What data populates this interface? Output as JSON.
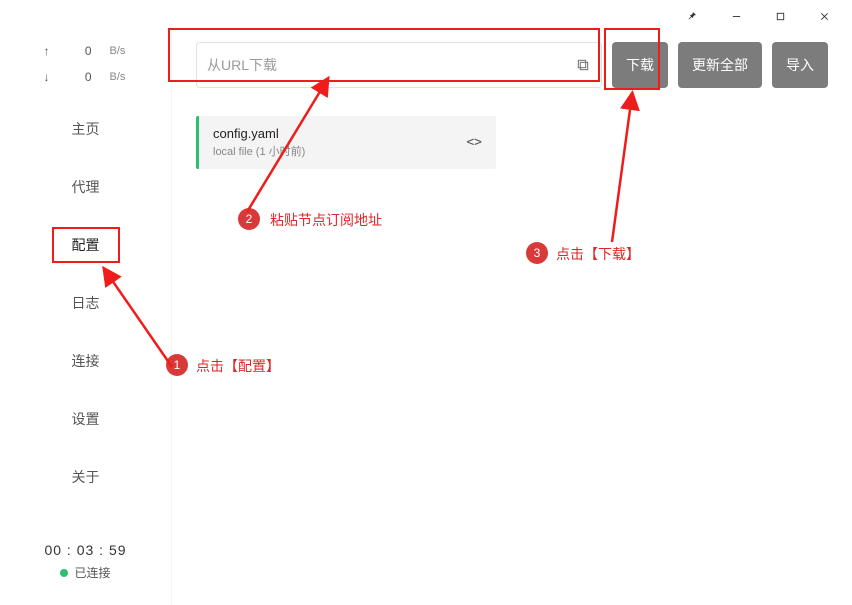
{
  "titlebar": {
    "pin": "📌",
    "minimize": "—",
    "maximize": "▢",
    "close": "✕"
  },
  "sidebar": {
    "speed": {
      "up_arrow": "↑",
      "up_val": "0",
      "up_unit": "B/s",
      "down_arrow": "↓",
      "down_val": "0",
      "down_unit": "B/s"
    },
    "items": [
      "主页",
      "代理",
      "配置",
      "日志",
      "连接",
      "设置",
      "关于"
    ],
    "active_index": 2,
    "timer": "00 : 03 : 59",
    "status_text": "已连接"
  },
  "toolbar": {
    "url_placeholder": "从URL下载",
    "download_label": "下载",
    "update_all_label": "更新全部",
    "import_label": "导入"
  },
  "card": {
    "title": "config.yaml",
    "subtitle": "local file (1 小时前)",
    "code": "<>"
  },
  "annotations": {
    "one_text": "点击【配置】",
    "two_text": "粘贴节点订阅地址",
    "three_text": "点击【下载】",
    "num1": "1",
    "num2": "2",
    "num3": "3"
  }
}
